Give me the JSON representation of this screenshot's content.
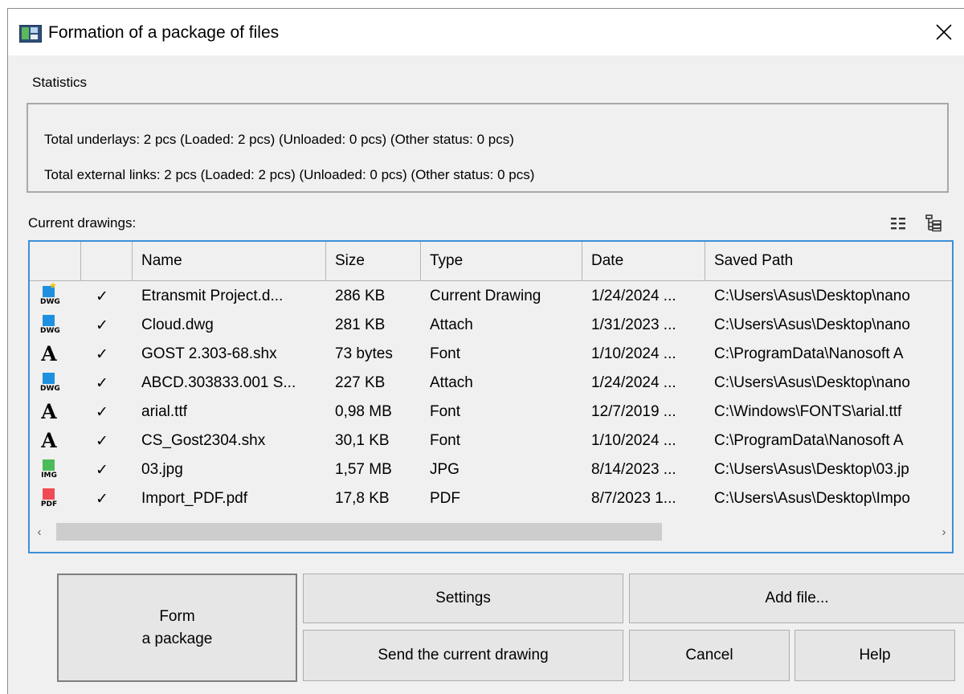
{
  "window": {
    "title": "Formation of a package of files",
    "close_glyph": "✕"
  },
  "statistics": {
    "label": "Statistics",
    "underlays": "Total underlays: 2 pcs (Loaded: 2 pcs) (Unloaded: 0 pcs) (Other status: 0 pcs)",
    "external_links": "Total external links: 2 pcs (Loaded: 2 pcs) (Unloaded: 0 pcs) (Other status: 0 pcs)"
  },
  "drawings": {
    "label": "Current drawings:",
    "view_icons": [
      "list-view-icon",
      "tree-view-icon"
    ],
    "columns": [
      "",
      "",
      "Name",
      "Size",
      "Type",
      "Date",
      "Saved Path"
    ],
    "rows": [
      {
        "icon": "dwg-current",
        "icon_tag": "DWG",
        "check": "✓",
        "name": "Etransmit Project.d...",
        "size": "286 KB",
        "type": "Current Drawing",
        "date": "1/24/2024 ...",
        "path": "C:\\Users\\Asus\\Desktop\\nano"
      },
      {
        "icon": "dwg",
        "icon_tag": "DWG",
        "check": "✓",
        "name": "Cloud.dwg",
        "size": "281 KB",
        "type": "Attach",
        "date": "1/31/2023 ...",
        "path": "C:\\Users\\Asus\\Desktop\\nano"
      },
      {
        "icon": "font",
        "icon_tag": "A",
        "check": "✓",
        "name": "GOST 2.303-68.shx",
        "size": "73 bytes",
        "type": "Font",
        "date": "1/10/2024 ...",
        "path": "C:\\ProgramData\\Nanosoft A"
      },
      {
        "icon": "dwg",
        "icon_tag": "DWG",
        "check": "✓",
        "name": "ABCD.303833.001 S...",
        "size": "227 KB",
        "type": "Attach",
        "date": "1/24/2024 ...",
        "path": "C:\\Users\\Asus\\Desktop\\nano"
      },
      {
        "icon": "font",
        "icon_tag": "A",
        "check": "✓",
        "name": "arial.ttf",
        "size": "0,98 MB",
        "type": "Font",
        "date": "12/7/2019 ...",
        "path": "C:\\Windows\\FONTS\\arial.ttf"
      },
      {
        "icon": "font",
        "icon_tag": "A",
        "check": "✓",
        "name": "CS_Gost2304.shx",
        "size": "30,1 KB",
        "type": "Font",
        "date": "1/10/2024 ...",
        "path": "C:\\ProgramData\\Nanosoft A"
      },
      {
        "icon": "img",
        "icon_tag": "IMG",
        "check": "✓",
        "name": "03.jpg",
        "size": "1,57 MB",
        "type": "JPG",
        "date": "8/14/2023 ...",
        "path": "C:\\Users\\Asus\\Desktop\\03.jp"
      },
      {
        "icon": "pdf",
        "icon_tag": "PDF",
        "check": "✓",
        "name": "Import_PDF.pdf",
        "size": "17,8 KB",
        "type": "PDF",
        "date": "8/7/2023 1...",
        "path": "C:\\Users\\Asus\\Desktop\\Impo"
      }
    ],
    "scroll_left": "‹",
    "scroll_right": "›",
    "scroll_position": 0
  },
  "buttons": {
    "form_line1": "Form",
    "form_line2": "a package",
    "settings": "Settings",
    "add_file": "Add file...",
    "send_current": "Send the current drawing",
    "cancel": "Cancel",
    "help": "Help"
  },
  "colors": {
    "dwg": "#1e90e0",
    "dwg_star": "#f5c400",
    "img": "#4cbb5a",
    "pdf": "#f04b55",
    "table_border": "#3c8fd6"
  }
}
